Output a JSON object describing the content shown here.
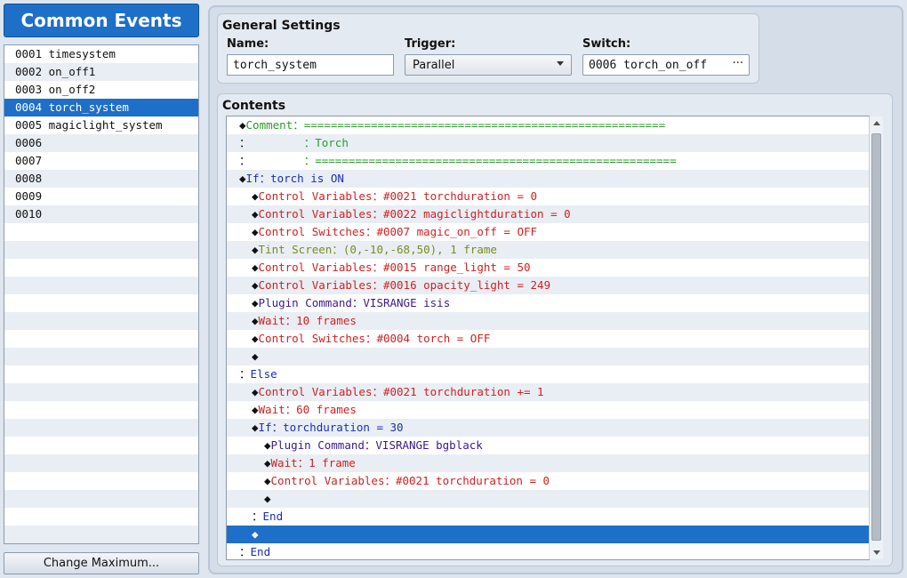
{
  "left": {
    "title": "Common Events",
    "events": [
      "0001 timesystem",
      "0002 on_off1",
      "0003 on_off2",
      "0004 torch_system",
      "0005 magiclight_system",
      "0006",
      "0007",
      "0008",
      "0009",
      "0010",
      "",
      "",
      "",
      "",
      "",
      "",
      "",
      "",
      "",
      "",
      "",
      "",
      "",
      "",
      "",
      "",
      "",
      ""
    ],
    "selected_index": 3,
    "change_max_label": "Change Maximum..."
  },
  "general": {
    "title": "General Settings",
    "name_label": "Name:",
    "name_value": "torch_system",
    "trigger_label": "Trigger:",
    "trigger_value": "Parallel",
    "switch_label": "Switch:",
    "switch_value": "0006 torch_on_off",
    "switch_button": "···"
  },
  "contents": {
    "title": "Contents",
    "selected_index": 23,
    "commands": [
      {
        "indent": 0,
        "prefix": "◆",
        "text": "Comment：======================================================",
        "style": "comment"
      },
      {
        "indent": 0,
        "prefix": "：",
        "text": "        ：Torch",
        "style": "comment"
      },
      {
        "indent": 0,
        "prefix": "：",
        "text": "        ：======================================================",
        "style": "comment"
      },
      {
        "indent": 0,
        "prefix": "◆",
        "text": "If：torch is ON",
        "style": "flow"
      },
      {
        "indent": 1,
        "prefix": "◆",
        "text": "Control Variables：#0021 torchduration = 0",
        "style": "var"
      },
      {
        "indent": 1,
        "prefix": "◆",
        "text": "Control Variables：#0022 magiclightduration = 0",
        "style": "var"
      },
      {
        "indent": 1,
        "prefix": "◆",
        "text": "Control Switches：#0007 magic_on_off = OFF",
        "style": "var"
      },
      {
        "indent": 1,
        "prefix": "◆",
        "text": "Tint Screen：(0,-10,-68,50), 1 frame",
        "style": "tint"
      },
      {
        "indent": 1,
        "prefix": "◆",
        "text": "Control Variables：#0015 range_light = 50",
        "style": "var"
      },
      {
        "indent": 1,
        "prefix": "◆",
        "text": "Control Variables：#0016 opacity_light = 249",
        "style": "var"
      },
      {
        "indent": 1,
        "prefix": "◆",
        "text": "Plugin Command：VISRANGE isis",
        "style": "plugin"
      },
      {
        "indent": 1,
        "prefix": "◆",
        "text": "Wait：10 frames",
        "style": "var"
      },
      {
        "indent": 1,
        "prefix": "◆",
        "text": "Control Switches：#0004 torch = OFF",
        "style": "var"
      },
      {
        "indent": 1,
        "prefix": "◆",
        "text": "",
        "style": "black"
      },
      {
        "indent": 0,
        "prefix": "：",
        "text": "Else",
        "style": "flow"
      },
      {
        "indent": 1,
        "prefix": "◆",
        "text": "Control Variables：#0021 torchduration += 1",
        "style": "var"
      },
      {
        "indent": 1,
        "prefix": "◆",
        "text": "Wait：60 frames",
        "style": "var"
      },
      {
        "indent": 1,
        "prefix": "◆",
        "text": "If：torchduration = 30",
        "style": "flow"
      },
      {
        "indent": 2,
        "prefix": "◆",
        "text": "Plugin Command：VISRANGE bgblack",
        "style": "plugin"
      },
      {
        "indent": 2,
        "prefix": "◆",
        "text": "Wait：1 frame",
        "style": "var"
      },
      {
        "indent": 2,
        "prefix": "◆",
        "text": "Control Variables：#0021 torchduration = 0",
        "style": "var"
      },
      {
        "indent": 2,
        "prefix": "◆",
        "text": "",
        "style": "black"
      },
      {
        "indent": 1,
        "prefix": "：",
        "text": "End",
        "style": "flow"
      },
      {
        "indent": 1,
        "prefix": "◆",
        "text": "",
        "style": "black"
      },
      {
        "indent": 0,
        "prefix": "：",
        "text": "End",
        "style": "flow"
      }
    ]
  }
}
